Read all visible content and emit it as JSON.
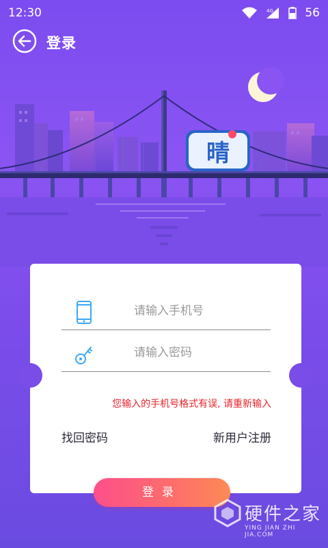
{
  "status_bar": {
    "time": "12:30",
    "network": "4G",
    "battery_level": "56"
  },
  "app_bar": {
    "title": "登录"
  },
  "scene": {
    "sign_text": "晴"
  },
  "form": {
    "phone_placeholder": "请输入手机号",
    "password_placeholder": "请输入密码",
    "error_message": "您输入的手机号格式有误, 请重新输入",
    "forgot_password": "找回密码",
    "register": "新用户注册"
  },
  "login_button": "登录",
  "watermark": {
    "title": "硬件之家",
    "subtitle": "YING JIAN ZHI JIA.COM"
  },
  "colors": {
    "accent": "#7c4cf0",
    "error": "#e8232b",
    "icon": "#3aa8f5"
  }
}
